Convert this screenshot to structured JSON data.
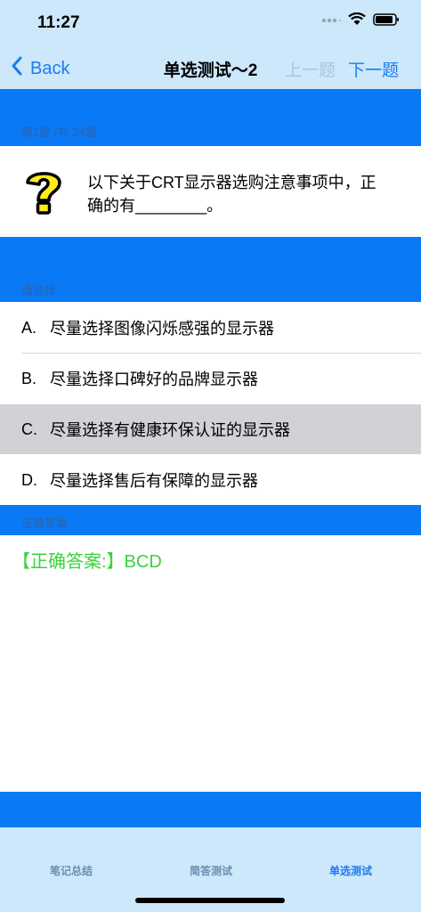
{
  "status_bar": {
    "time": "11:27"
  },
  "nav": {
    "back_label": "Back",
    "title": "单选测试～2",
    "prev_label": "上一题",
    "next_label": "下一题"
  },
  "question": {
    "counter": "第1题 /共 24题",
    "text": "以下关于CRT显示器选购注意事项中，正确的有________。",
    "icon": "question-mark-icon"
  },
  "options_header": "请选择",
  "options": [
    {
      "letter": "A.",
      "text": "尽量选择图像闪烁感强的显示器"
    },
    {
      "letter": "B.",
      "text": "尽量选择口碑好的品牌显示器"
    },
    {
      "letter": "C.",
      "text": "尽量选择有健康环保认证的显示器"
    },
    {
      "letter": "D.",
      "text": "尽量选择售后有保障的显示器"
    }
  ],
  "answer_header": "正确答案",
  "answer_text": "【正确答案:】BCD",
  "tabs": [
    {
      "label": "笔记总结"
    },
    {
      "label": "简答测试"
    },
    {
      "label": "单选测试"
    }
  ],
  "colors": {
    "band_blue": "#0a79f6",
    "bar_bg": "#cde7fb",
    "accent": "#1a7cf3",
    "answer_green": "#38d33a",
    "selected_row": "#d1d1d6"
  }
}
